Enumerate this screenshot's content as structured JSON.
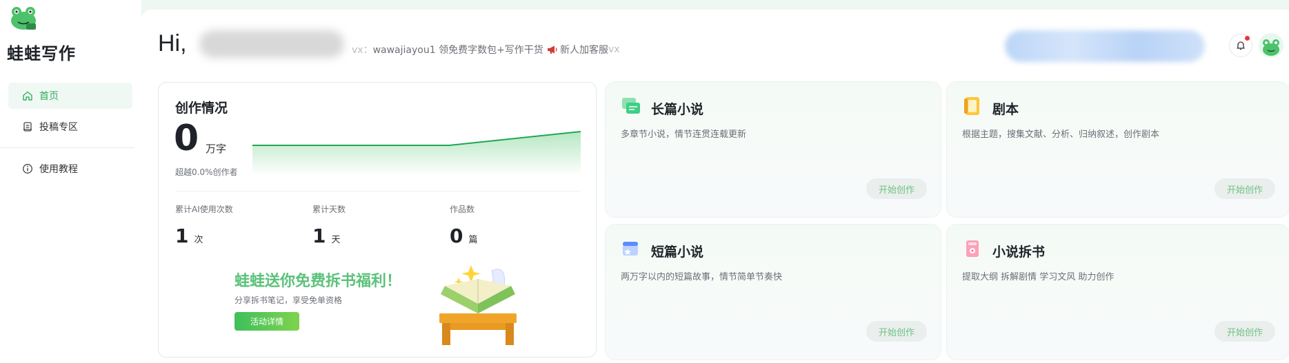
{
  "sidebar": {
    "brand": "蛙蛙写作",
    "items": [
      {
        "label": "首页",
        "icon": "home-icon",
        "active": true
      },
      {
        "label": "投稿专区",
        "icon": "submission-icon",
        "active": false
      },
      {
        "label": "使用教程",
        "icon": "info-icon",
        "active": false
      }
    ]
  },
  "header": {
    "greeting": "Hi,",
    "promo_prefix": "vx：",
    "promo_text": "wawajiayou1 领免费字数包+写作干货",
    "notice_text": "新人加客服",
    "notice_suffix": "vx"
  },
  "stats": {
    "title": "创作情况",
    "total_words": "0",
    "total_words_unit": "万字",
    "beat_text": "超越0.0%创作者",
    "trend": [
      0,
      0,
      0,
      0,
      0.5,
      1
    ],
    "metrics": [
      {
        "label": "累计AI使用次数",
        "value": "1",
        "unit": "次"
      },
      {
        "label": "累计天数",
        "value": "1",
        "unit": "天"
      },
      {
        "label": "作品数",
        "value": "0",
        "unit": "篇"
      }
    ],
    "banner": {
      "title": "蛙蛙送你免费拆书福利！",
      "subtitle": "分享拆书笔记，享受免单资格",
      "button": "活动详情"
    }
  },
  "features": [
    {
      "title": "长篇小说",
      "desc": "多章节小说，情节连贯连载更新",
      "button": "开始创作",
      "icon": "novel-icon"
    },
    {
      "title": "剧本",
      "desc": "根据主题，搜集文献、分析、归纳叙述，创作剧本",
      "button": "开始创作",
      "icon": "script-icon"
    },
    {
      "title": "短篇小说",
      "desc": "两万字以内的短篇故事，情节简单节奏快",
      "button": "开始创作",
      "icon": "short-story-icon"
    },
    {
      "title": "小说拆书",
      "desc": "提取大纲 拆解剧情 学习文风 助力创作",
      "button": "开始创作",
      "icon": "book-split-icon"
    }
  ],
  "colors": {
    "accent": "#2fae5f",
    "banner_title": "#5bc27a",
    "notify_dot": "#e53b3b"
  }
}
